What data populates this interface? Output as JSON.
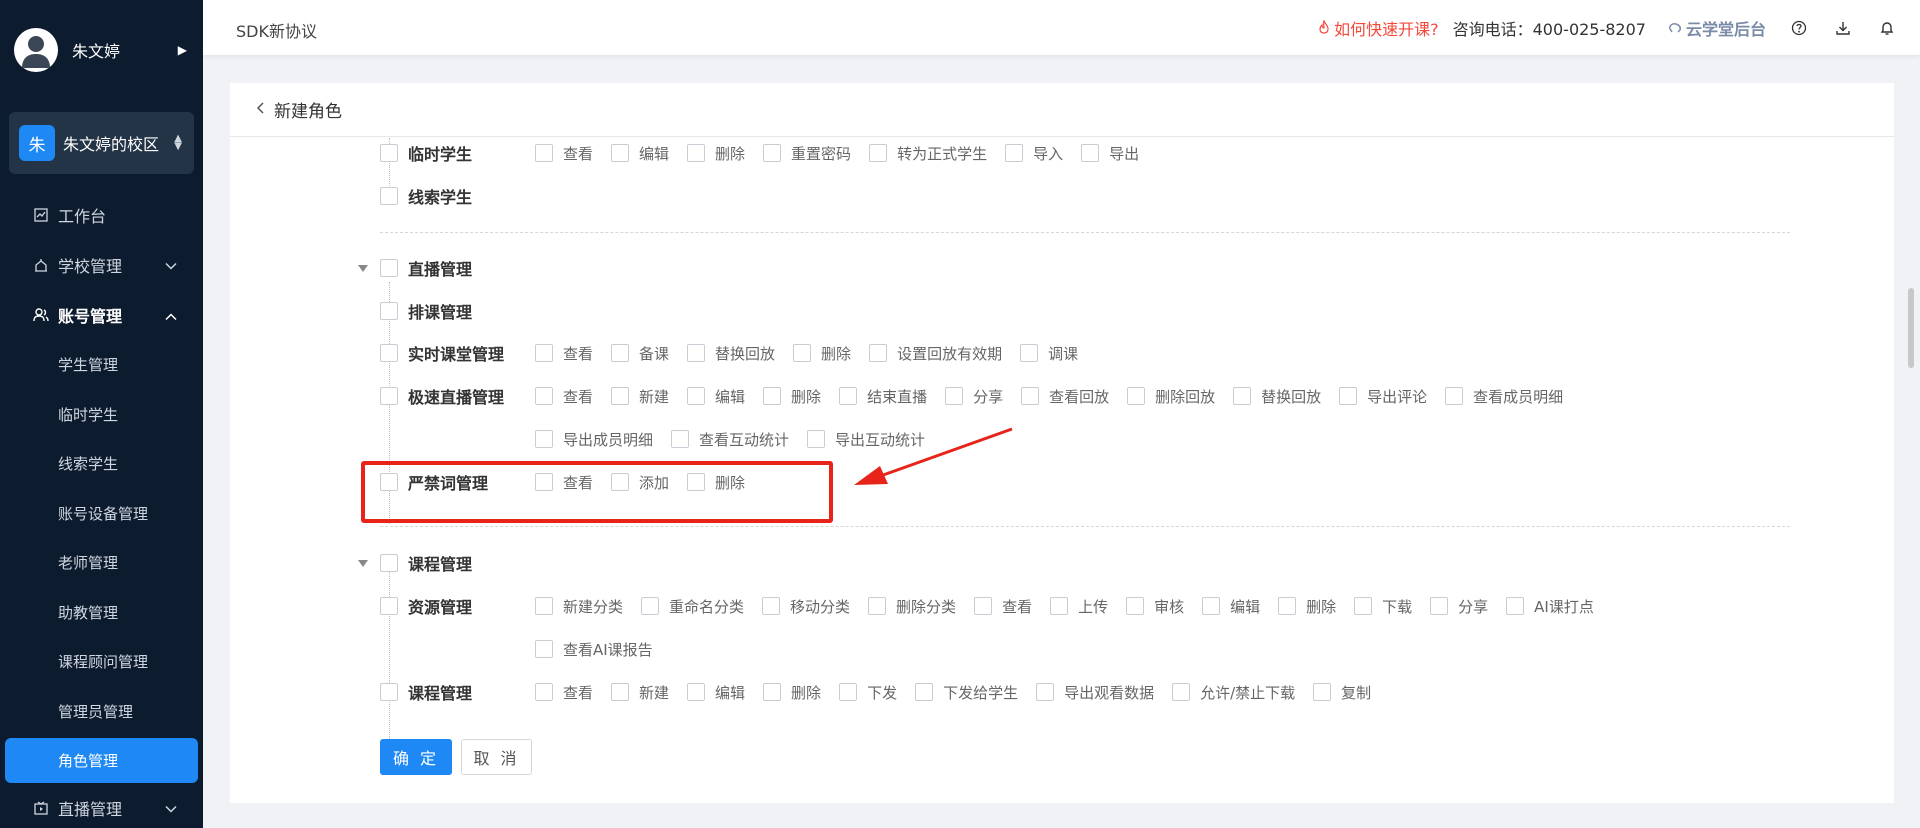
{
  "sidebar": {
    "user_name": "朱文婷",
    "campus_badge": "朱",
    "campus_name": "朱文婷的校区",
    "menu": {
      "workbench": "工作台",
      "school": "学校管理",
      "account": "账号管理",
      "live": "直播管理"
    },
    "sub_items": [
      "学生管理",
      "临时学生",
      "线索学生",
      "账号设备管理",
      "老师管理",
      "助教管理",
      "课程顾问管理",
      "管理员管理",
      "角色管理"
    ],
    "active_sub": "角色管理"
  },
  "topbar": {
    "title": "SDK新协议",
    "fast_start": "如何快速开课?",
    "phone": "咨询电话：400-025-8207",
    "backend": "云学堂后台"
  },
  "page": {
    "back_title": "新建角色"
  },
  "permissions": {
    "temp_student": {
      "label": "临时学生",
      "perms": [
        "查看",
        "编辑",
        "删除",
        "重置密码",
        "转为正式学生",
        "导入",
        "导出"
      ]
    },
    "lead_student": {
      "label": "线索学生"
    },
    "live_group": {
      "label": "直播管理"
    },
    "schedule": {
      "label": "排课管理"
    },
    "realtime": {
      "label": "实时课堂管理",
      "perms": [
        "查看",
        "备课",
        "替换回放",
        "删除",
        "设置回放有效期",
        "调课"
      ]
    },
    "fastlive": {
      "label": "极速直播管理",
      "perms": [
        "查看",
        "新建",
        "编辑",
        "删除",
        "结束直播",
        "分享",
        "查看回放",
        "删除回放",
        "替换回放",
        "导出评论",
        "查看成员明细"
      ],
      "perms2": [
        "导出成员明细",
        "查看互动统计",
        "导出互动统计"
      ]
    },
    "banned": {
      "label": "严禁词管理",
      "perms": [
        "查看",
        "添加",
        "删除"
      ]
    },
    "course_group": {
      "label": "课程管理"
    },
    "resource": {
      "label": "资源管理",
      "perms": [
        "新建分类",
        "重命名分类",
        "移动分类",
        "删除分类",
        "查看",
        "上传",
        "审核",
        "编辑",
        "删除",
        "下载",
        "分享",
        "AI课打点"
      ],
      "perms2": [
        "查看AI课报告"
      ]
    },
    "course": {
      "label": "课程管理",
      "perms": [
        "查看",
        "新建",
        "编辑",
        "删除",
        "下发",
        "下发给学生",
        "导出观看数据",
        "允许/禁止下载",
        "复制"
      ]
    }
  },
  "buttons": {
    "confirm": "确 定",
    "cancel": "取 消"
  },
  "colors": {
    "primary": "#1e88f5",
    "sidebar_bg": "#0d1b2e",
    "highlight": "#e8231a"
  }
}
